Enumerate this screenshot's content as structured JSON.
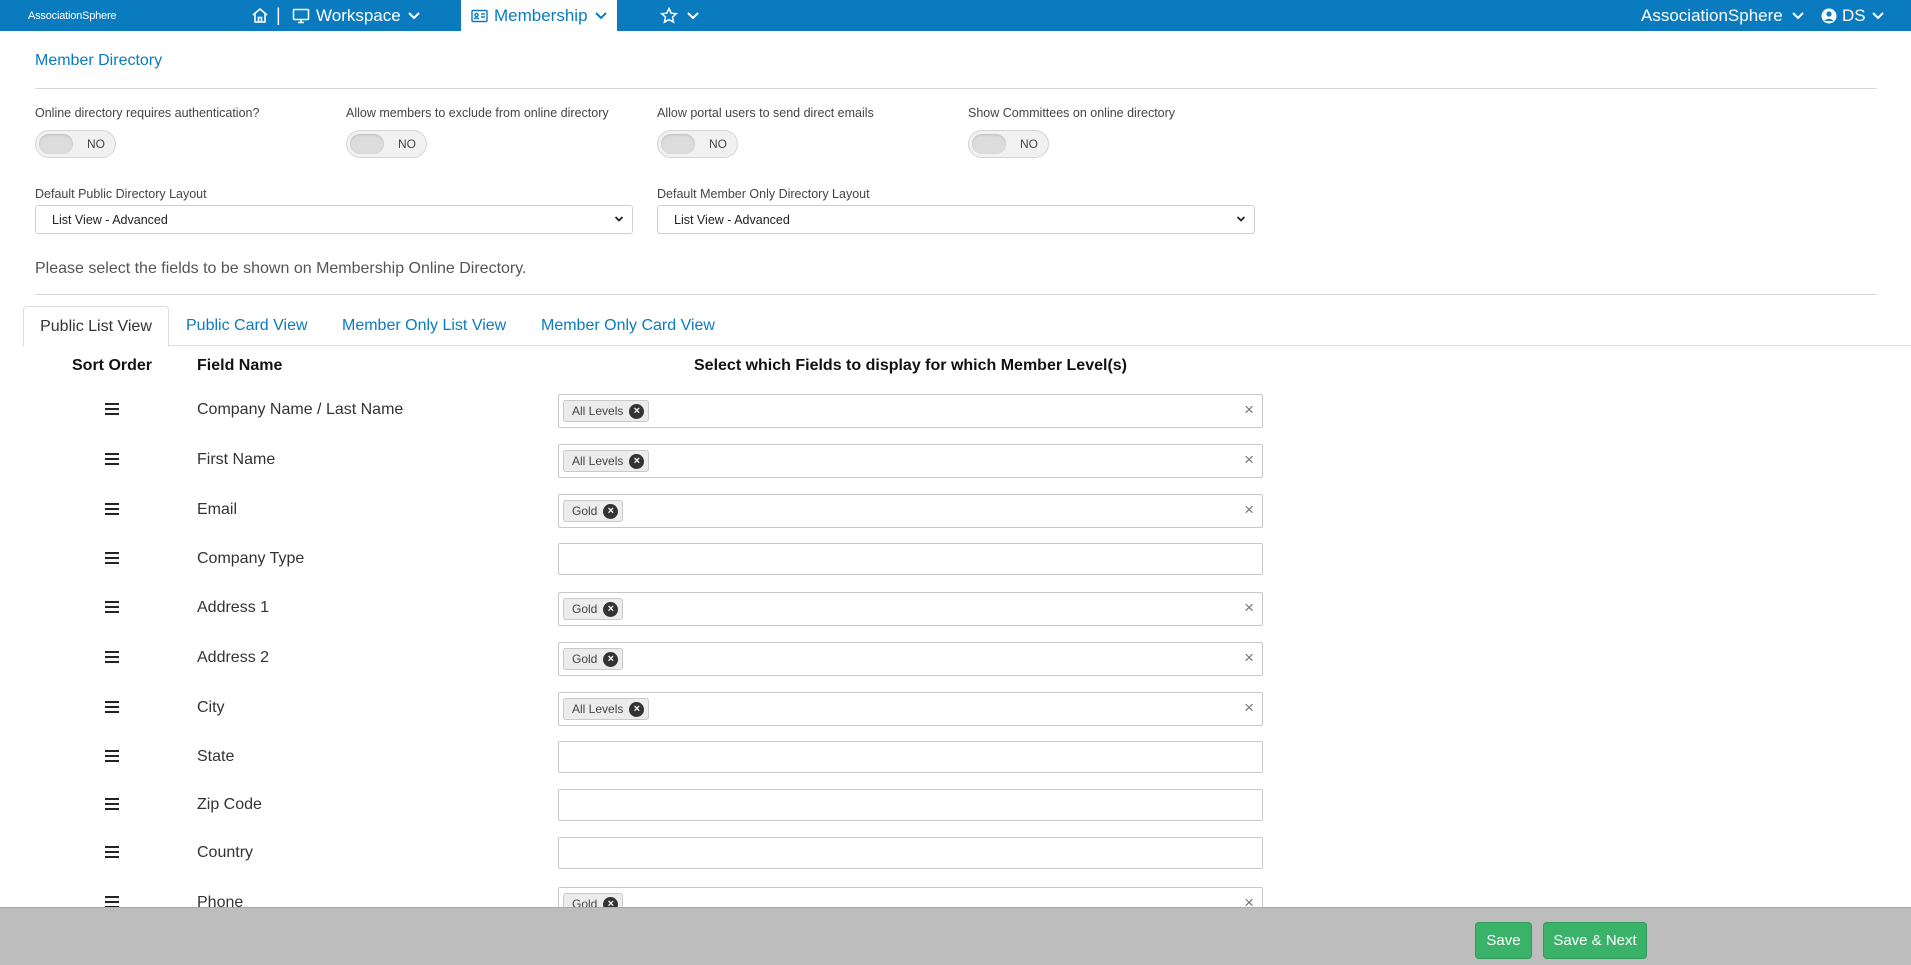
{
  "navbar": {
    "logo_text": "AssociationSphere",
    "workspace_label": "Workspace",
    "membership_label": "Membership",
    "separator": "|",
    "org_label": "AssociationSphere",
    "user_initials": "DS",
    "brand_color": "#0a7bbf",
    "icons": [
      "home-icon",
      "monitor-icon",
      "id-card-icon",
      "star-icon",
      "user-circle-icon",
      "chevron-down-icon"
    ]
  },
  "page": {
    "title": "Member Directory",
    "instructions": "Please select the fields to be shown on Membership Online Directory."
  },
  "toggles": [
    {
      "label": "Online directory requires authentication?",
      "state": "NO"
    },
    {
      "label": "Allow members to exclude from online directory",
      "state": "NO"
    },
    {
      "label": "Allow portal users to send direct emails",
      "state": "NO"
    },
    {
      "label": "Show Committees on online directory",
      "state": "NO"
    }
  ],
  "selects": [
    {
      "label": "Default Public Directory Layout",
      "value": "List View - Advanced"
    },
    {
      "label": "Default Member Only Directory Layout",
      "value": "List View - Advanced"
    }
  ],
  "tabs": [
    {
      "label": "Public List View",
      "active": true
    },
    {
      "label": "Public Card View",
      "active": false
    },
    {
      "label": "Member Only List View",
      "active": false
    },
    {
      "label": "Member Only Card View",
      "active": false
    }
  ],
  "table": {
    "headers": {
      "sort": "Sort Order",
      "field": "Field Name",
      "select": "Select which Fields to display for which Member Level(s)"
    },
    "rows": [
      {
        "field": "Company Name / Last Name",
        "levels": [
          "All Levels"
        ]
      },
      {
        "field": "First Name",
        "levels": [
          "All Levels"
        ]
      },
      {
        "field": "Email",
        "levels": [
          "Gold"
        ]
      },
      {
        "field": "Company Type",
        "levels": []
      },
      {
        "field": "Address 1",
        "levels": [
          "Gold"
        ]
      },
      {
        "field": "Address 2",
        "levels": [
          "Gold"
        ]
      },
      {
        "field": "City",
        "levels": [
          "All Levels"
        ]
      },
      {
        "field": "State",
        "levels": []
      },
      {
        "field": "Zip Code",
        "levels": []
      },
      {
        "field": "Country",
        "levels": []
      },
      {
        "field": "Phone",
        "levels": [
          "Gold"
        ]
      }
    ]
  },
  "footer": {
    "save_label": "Save",
    "save_next_label": "Save & Next",
    "button_color": "#3ab26a"
  }
}
